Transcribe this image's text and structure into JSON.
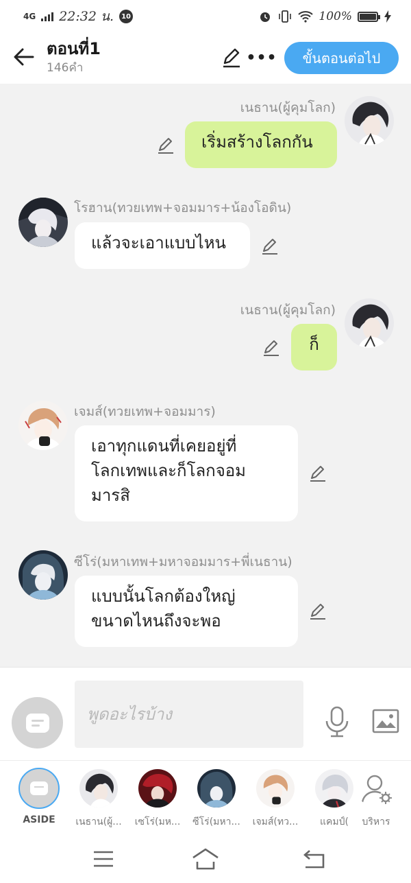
{
  "status_bar": {
    "network": "4G",
    "time": "22:32 น.",
    "notification_badge": "10",
    "battery": "100%"
  },
  "header": {
    "title": "ตอนที่1",
    "word_count": "146คำ",
    "next_button": "ขั้นตอนต่อไป"
  },
  "messages": [
    {
      "side": "right",
      "name": "เนธาน(ผู้คุมโลก)",
      "text": "เริ่มสร้างโลกกัน"
    },
    {
      "side": "left",
      "name": "โรฮาน(ทวยเทพ+จอมมาร+น้องโอดิน)",
      "text": "แล้วจะเอาแบบไหน"
    },
    {
      "side": "right",
      "name": "เนธาน(ผู้คุมโลก)",
      "text": "ก็"
    },
    {
      "side": "left",
      "name": "เจมส์(ทวยเทพ+จอมมาร)",
      "text_lines": [
        "เอาทุกแดนที่เคยอยู่ที่",
        "โลกเทพและก็โลกจอม",
        "มารสิ"
      ]
    },
    {
      "side": "left",
      "name": "ซีโร่(มหาเทพ+มหาจอมมาร+พี่เนธาน)",
      "text_lines": [
        "แบบนั้นโลกต้องใหญ่",
        "ขนาดไหนถึงจะพอ"
      ]
    }
  ],
  "composer": {
    "placeholder": "พูดอะไรบ้าง"
  },
  "characters": [
    {
      "label": "ASIDE"
    },
    {
      "label": "เนธาน(ผู้..."
    },
    {
      "label": "เซโร่(มห..."
    },
    {
      "label": "ซีโร่(มหา..."
    },
    {
      "label": "เจมส์(ทว..."
    },
    {
      "label": "แคมป์("
    },
    {
      "label": "บริหาร"
    }
  ],
  "colors": {
    "accent": "#4aa9f2",
    "my_bubble": "#d8f39a",
    "their_bubble": "#ffffff",
    "background": "#f2f2f2"
  }
}
